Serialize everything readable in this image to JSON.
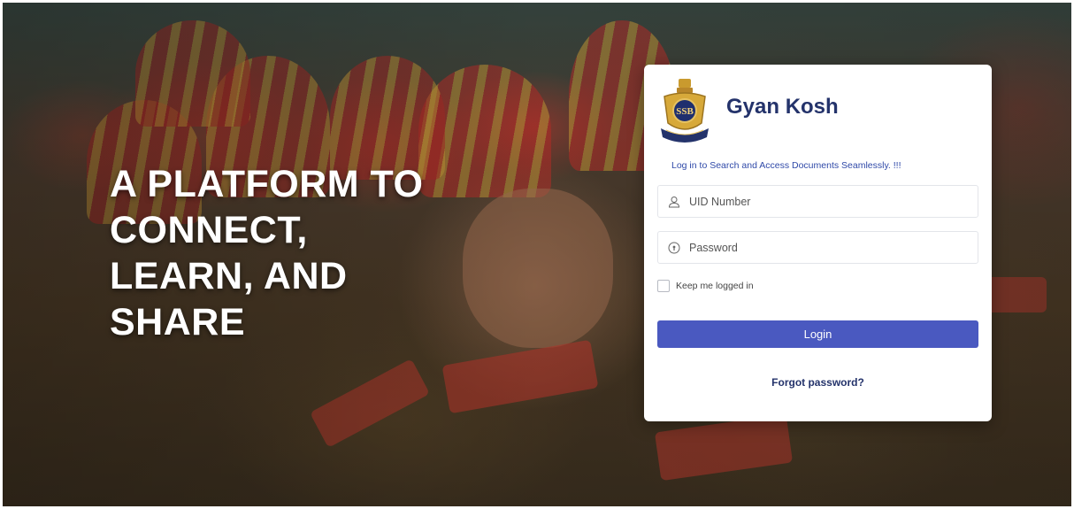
{
  "hero": {
    "tagline_lines": [
      "A PLATFORM TO",
      "CONNECT,",
      "LEARN, AND",
      "SHARE"
    ],
    "background": "photo-of-uniformed-personnel"
  },
  "login_card": {
    "logo_icon": "ssb-emblem-icon",
    "brand_name": "Gyan Kosh",
    "subtitle": "Log in to Search and Access Documents Seamlessly. !!!",
    "uid_field": {
      "placeholder": "UID Number",
      "value": "",
      "icon": "user-icon"
    },
    "password_field": {
      "placeholder": "Password",
      "value": "",
      "icon": "lock-shield-icon"
    },
    "remember_label": "Keep me logged in",
    "remember_checked": false,
    "login_label": "Login",
    "forgot_label": "Forgot password?"
  },
  "colors": {
    "brand_navy": "#24336b",
    "accent_blue": "#4a59c0",
    "subtitle_blue": "#2f49a8",
    "card_bg": "#ffffff"
  }
}
